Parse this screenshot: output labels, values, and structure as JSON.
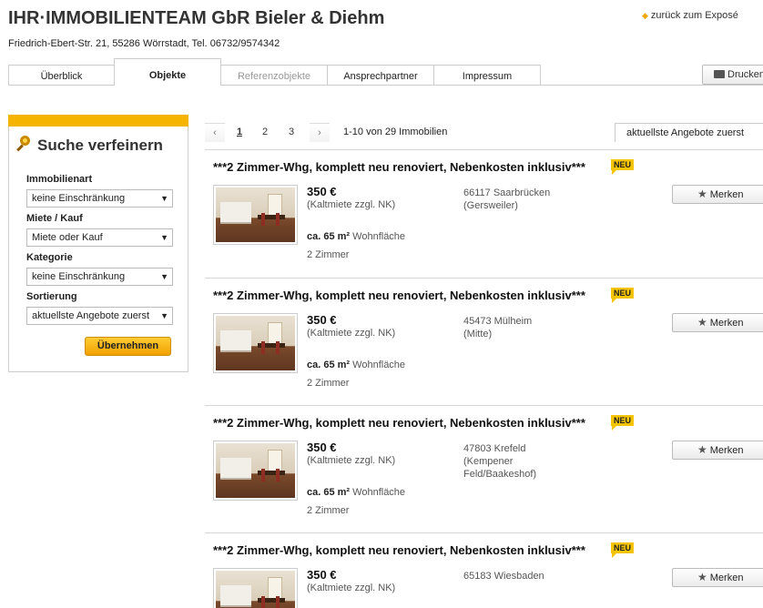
{
  "header": {
    "company": "IHR·IMMOBILIENTEAM GbR Bieler & Diehm",
    "back_link": "zurück zum Exposé",
    "address": "Friedrich-Ebert-Str. 21, 55286 Wörrstadt, Tel. 06732/9574342",
    "print_label": "Drucken"
  },
  "tabs": [
    {
      "label": "Überblick"
    },
    {
      "label": "Objekte"
    },
    {
      "label": "Referenzobjekte"
    },
    {
      "label": "Ansprechpartner"
    },
    {
      "label": "Impressum"
    }
  ],
  "sidebar": {
    "title": "Suche verfeinern",
    "filters": [
      {
        "label": "Immobilienart",
        "value": "keine Einschränkung"
      },
      {
        "label": "Miete / Kauf",
        "value": "Miete oder Kauf"
      },
      {
        "label": "Kategorie",
        "value": "keine Einschränkung"
      },
      {
        "label": "Sortierung",
        "value": "aktuellste Angebote zuerst"
      }
    ],
    "apply_label": "Übernehmen"
  },
  "pagination": {
    "prev": "‹",
    "next": "›",
    "pages": [
      "1",
      "2",
      "3"
    ],
    "current": "1",
    "count_text": "1-10 von 29 Immobilien",
    "sort_value": "aktuellste Angebote zuerst"
  },
  "listings": [
    {
      "title": "***2 Zimmer-Whg, komplett neu renoviert, Nebenkosten inklusiv***",
      "badge": "NEU",
      "price": "350 €",
      "price_note": "(Kaltmiete zzgl. NK)",
      "location_line1": "66117 Saarbrücken",
      "location_line2": "(Gersweiler)",
      "area_value": "ca. 65 m²",
      "area_label": "Wohnfläche",
      "rooms": "2 Zimmer",
      "save_label": "Merken"
    },
    {
      "title": "***2 Zimmer-Whg, komplett neu renoviert, Nebenkosten inklusiv***",
      "badge": "NEU",
      "price": "350 €",
      "price_note": "(Kaltmiete zzgl. NK)",
      "location_line1": "45473 Mülheim",
      "location_line2": "(Mitte)",
      "area_value": "ca. 65 m²",
      "area_label": "Wohnfläche",
      "rooms": "2 Zimmer",
      "save_label": "Merken"
    },
    {
      "title": "***2 Zimmer-Whg, komplett neu renoviert, Nebenkosten inklusiv***",
      "badge": "NEU",
      "price": "350 €",
      "price_note": "(Kaltmiete zzgl. NK)",
      "location_line1": "47803 Krefeld",
      "location_line2": "(Kempener Feld/Baakeshof)",
      "area_value": "ca. 65 m²",
      "area_label": "Wohnfläche",
      "rooms": "2 Zimmer",
      "save_label": "Merken"
    },
    {
      "title": "***2 Zimmer-Whg, komplett neu renoviert, Nebenkosten inklusiv***",
      "badge": "NEU",
      "price": "350 €",
      "price_note": "(Kaltmiete zzgl. NK)",
      "location_line1": "65183 Wiesbaden",
      "location_line2": "",
      "area_value": "",
      "area_label": "",
      "rooms": "",
      "save_label": "Merken"
    }
  ]
}
